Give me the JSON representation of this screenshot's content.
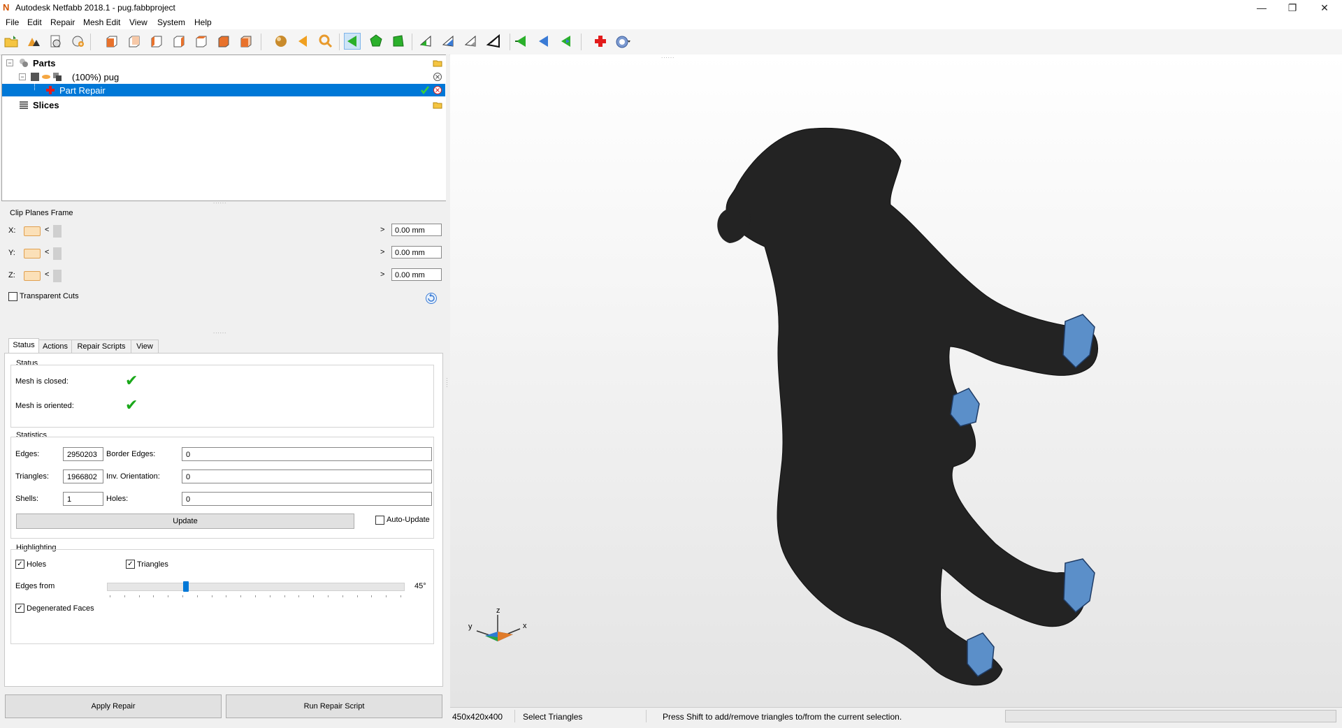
{
  "window": {
    "title": "Autodesk Netfabb 2018.1 - pug.fabbproject",
    "app_icon": "N",
    "minimize": "—",
    "restore": "❐",
    "close": "✕"
  },
  "menu": [
    "File",
    "Edit",
    "Repair",
    "Mesh Edit",
    "View",
    "System",
    "Help"
  ],
  "toolbar": {
    "icons": [
      "open-folder-icon",
      "add-part-icon",
      "new-project-icon",
      "add-platform-icon",
      "view-front-icon",
      "view-back-icon",
      "view-left-icon",
      "view-right-icon",
      "view-top-icon",
      "view-bottom-icon",
      "view-iso-icon",
      "sphere-shading-icon",
      "arrow-left-icon",
      "zoom-icon",
      "select-triangles-icon",
      "select-surface-icon",
      "select-shell-icon",
      "select-plane-icon",
      "select-edge-icon",
      "select-mesh-icon",
      "select-all-icon",
      "select-invert-icon",
      "select-grow-icon",
      "select-shrink-icon",
      "repair-cross-icon",
      "help-icon"
    ]
  },
  "tree": {
    "parts_label": "Parts",
    "pug_label": "(100%) pug",
    "repair_label": "Part Repair",
    "slices_label": "Slices"
  },
  "clip": {
    "title": "Clip Planes Frame",
    "rows": [
      {
        "axis": "X:",
        "value": "0.00 mm"
      },
      {
        "axis": "Y:",
        "value": "0.00 mm"
      },
      {
        "axis": "Z:",
        "value": "0.00 mm"
      }
    ],
    "left_arrow": "<",
    "right_arrow": ">",
    "transparent_cuts": "Transparent Cuts"
  },
  "tabs": [
    "Status",
    "Actions",
    "Repair Scripts",
    "View"
  ],
  "status": {
    "group_title": "Status",
    "closed_label": "Mesh is closed:",
    "oriented_label": "Mesh is oriented:",
    "check": "✔"
  },
  "statistics": {
    "group_title": "Statistics",
    "edges_label": "Edges:",
    "edges_value": "2950203",
    "border_edges_label": "Border Edges:",
    "border_edges_value": "0",
    "triangles_label": "Triangles:",
    "triangles_value": "1966802",
    "inv_orientation_label": "Inv. Orientation:",
    "inv_orientation_value": "0",
    "shells_label": "Shells:",
    "shells_value": "1",
    "holes_label": "Holes:",
    "holes_value": "0",
    "update_button": "Update",
    "auto_update_label": "Auto-Update"
  },
  "highlighting": {
    "group_title": "Highlighting",
    "holes_label": "Holes",
    "triangles_label": "Triangles",
    "edges_from_label": "Edges from",
    "edges_from_value": "45°",
    "edges_from_fraction": 0.26,
    "degenerated_label": "Degenerated Faces",
    "checkmark": "✓"
  },
  "buttons": {
    "apply_repair": "Apply Repair",
    "run_repair_script": "Run Repair Script"
  },
  "axes": {
    "x": "x",
    "y": "y",
    "z": "z"
  },
  "statusbar": {
    "dimensions": "450x420x400",
    "mode": "Select Triangles",
    "hint": "Press Shift to add/remove triangles to/from the current selection."
  },
  "colors": {
    "selection_blue": "#0078d7",
    "mesh_dark": "#222222",
    "highlight_blue": "#5b8fc9",
    "check_green": "#1aa81a"
  }
}
